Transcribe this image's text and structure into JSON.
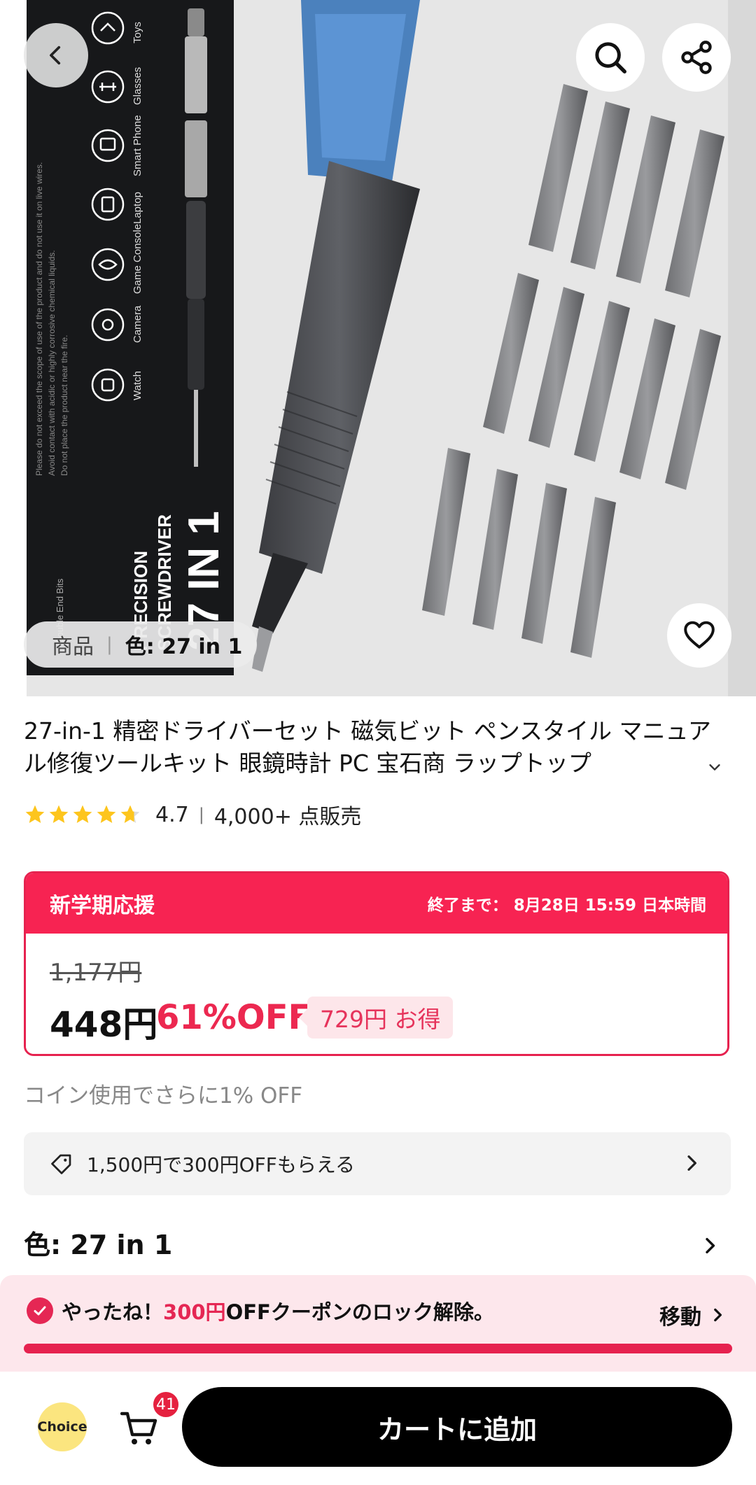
{
  "hero": {
    "box_title": "27 IN 1",
    "box_subtitle_1": "PRECISION",
    "box_subtitle_2": "SCREWDRIVER",
    "box_caption": "Double End Bits",
    "categories": [
      "Toys",
      "Glasses",
      "Smart Phone",
      "Laptop",
      "Game Console",
      "Camera",
      "Watch"
    ],
    "box_notes": [
      "Please do not exceed the scope of use of the product and do not use it on live wires.",
      "Avoid contact with acidic or highly corrosive chemical liquids.",
      "Do not place the product near the fire."
    ],
    "chip_product": "商品",
    "chip_separator": "|",
    "chip_variant": "色: 27 in 1"
  },
  "product": {
    "title": "27-in-1 精密ドライバーセット 磁気ビット ペンスタイル マニュアル修復ツールキット 眼鏡時計 PC 宝石商 ラップトップ",
    "rating": "4.7",
    "sold": "4,000+ 点販売"
  },
  "promo": {
    "title": "新学期応援",
    "end_text": "終了まで： 8月28日 15:59 日本時間",
    "original_price": "1,177円",
    "price": "448円",
    "discount": "61%OFF",
    "savings": "729円 お得"
  },
  "coin_text": "コイン使用でさらに1% OFF",
  "coupon_text": "1,500円で300円OFFもらえる",
  "color_label": "色: 27 in 1",
  "unlock": {
    "prefix": "やったね！",
    "amount": "300円",
    "suffix": "OFFクーポンのロック解除。",
    "go_label": "移動"
  },
  "bottom": {
    "choice_label": "Choice",
    "cart_count": "41",
    "add_to_cart": "カートに追加"
  },
  "colors": {
    "accent": "#f72352",
    "discount": "#ec2850",
    "button": "#000000",
    "choice_bg": "#fbe57f"
  }
}
